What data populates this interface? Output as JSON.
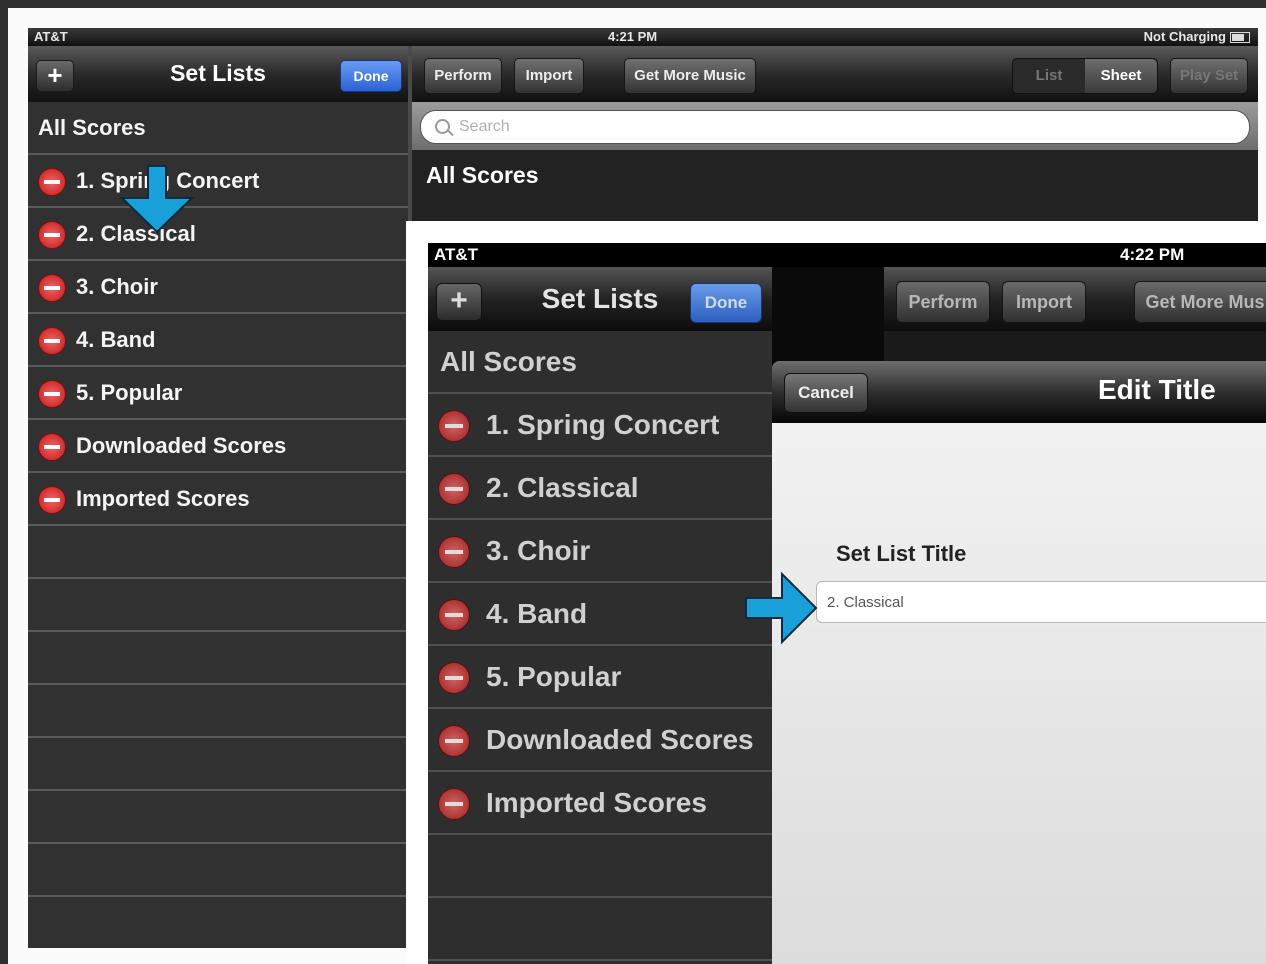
{
  "back_screen": {
    "status": {
      "carrier": "AT&T",
      "time": "4:21 PM",
      "battery": "Not Charging"
    },
    "sidebar": {
      "title": "Set Lists",
      "add_label": "+",
      "done_label": "Done",
      "header": "All Scores",
      "items": [
        {
          "label": "1. Spring Concert"
        },
        {
          "label": "2. Classical"
        },
        {
          "label": "3. Choir"
        },
        {
          "label": "4. Band"
        },
        {
          "label": "5. Popular"
        },
        {
          "label": "Downloaded Scores"
        },
        {
          "label": "Imported Scores"
        }
      ]
    },
    "toolbar": {
      "perform": "Perform",
      "import": "Import",
      "get_more": "Get More Music",
      "segment": [
        "List",
        "Sheet"
      ],
      "play_set": "Play Set"
    },
    "search": {
      "placeholder": "Search"
    },
    "section_title": "All Scores"
  },
  "front_screen": {
    "status": {
      "carrier": "AT&T",
      "time": "4:22 PM"
    },
    "sidebar": {
      "title": "Set Lists",
      "add_label": "+",
      "done_label": "Done",
      "header": "All Scores",
      "items": [
        {
          "label": "1. Spring Concert"
        },
        {
          "label": "2. Classical"
        },
        {
          "label": "3. Choir"
        },
        {
          "label": "4. Band"
        },
        {
          "label": "5. Popular"
        },
        {
          "label": "Downloaded Scores"
        },
        {
          "label": "Imported Scores"
        }
      ]
    },
    "toolbar": {
      "perform": "Perform",
      "import": "Import",
      "get_more": "Get More Mus"
    },
    "modal": {
      "cancel": "Cancel",
      "title": "Edit Title",
      "field_label": "Set List Title",
      "field_value": "2. Classical"
    }
  },
  "colors": {
    "arrow": "#1aa0d8",
    "done_blue": "#2b62d6",
    "delete_red": "#c21818"
  }
}
